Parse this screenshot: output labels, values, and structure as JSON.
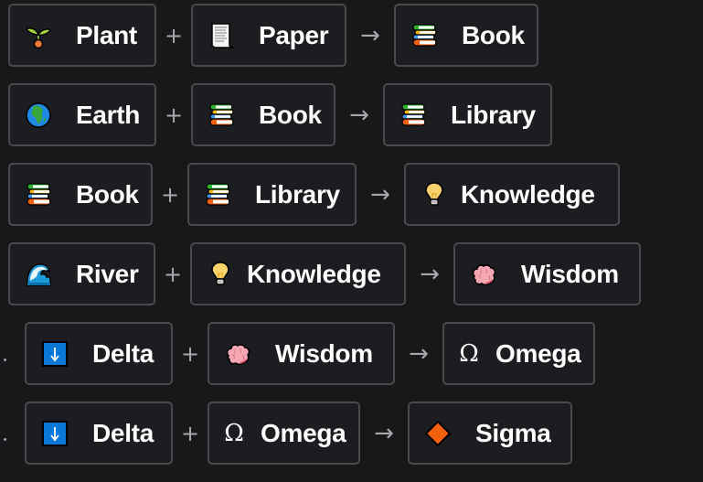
{
  "operators": {
    "plus": "+",
    "arrow": "→"
  },
  "recipes": [
    {
      "first": {
        "label": "Plant",
        "icon": "seedling-icon"
      },
      "second": {
        "label": "Paper",
        "icon": "page-icon"
      },
      "result": {
        "label": "Book",
        "icon": "books-icon"
      }
    },
    {
      "first": {
        "label": "Earth",
        "icon": "globe-africa-icon"
      },
      "second": {
        "label": "Book",
        "icon": "books-icon"
      },
      "result": {
        "label": "Library",
        "icon": "books-icon"
      }
    },
    {
      "first": {
        "label": "Book",
        "icon": "books-icon"
      },
      "second": {
        "label": "Library",
        "icon": "books-icon"
      },
      "result": {
        "label": "Knowledge",
        "icon": "lightbulb-icon"
      }
    },
    {
      "first": {
        "label": "River",
        "icon": "wave-icon"
      },
      "second": {
        "label": "Knowledge",
        "icon": "lightbulb-icon"
      },
      "result": {
        "label": "Wisdom",
        "icon": "brain-icon"
      }
    },
    {
      "bullet": "·",
      "first": {
        "label": "Delta",
        "icon": "down-arrow-box-icon"
      },
      "second": {
        "label": "Wisdom",
        "icon": "brain-icon"
      },
      "result": {
        "label": "Omega",
        "icon": "omega-icon",
        "glyph": "Ω"
      }
    },
    {
      "bullet": "·",
      "first": {
        "label": "Delta",
        "icon": "down-arrow-box-icon"
      },
      "second": {
        "label": "Omega",
        "icon": "omega-icon",
        "glyph": "Ω"
      },
      "result": {
        "label": "Sigma",
        "icon": "orange-diamond-icon"
      }
    }
  ],
  "colors": {
    "background": "#18181b",
    "chip_background": "#1c1d21",
    "chip_border": "#4a4a4d",
    "text": "#ffffff",
    "operator": "#a8a8ac",
    "delta_blue": "#0a78d7",
    "sigma_orange": "#f4600c"
  }
}
